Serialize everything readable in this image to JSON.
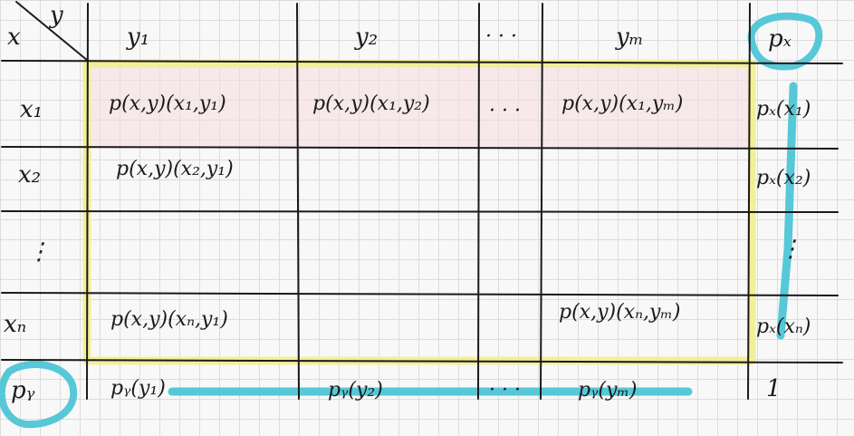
{
  "colors": {
    "ink": "#1a1a1a",
    "grid": "#dcdcdc",
    "highlight_yellow": "#f2ef9a",
    "highlight_pink": "#f6dcdc",
    "highlight_cyan": "#56c8d8"
  },
  "corner": {
    "x_label": "x",
    "y_label": "y"
  },
  "header": {
    "y1": "y₁",
    "y2": "y₂",
    "dots": "· · ·",
    "ym": "yₘ",
    "px": "pₓ"
  },
  "rows": [
    {
      "x": "x₁",
      "cells": [
        "p(x,y)(x₁,y₁)",
        "p(x,y)(x₁,y₂)",
        "· · ·",
        "p(x,y)(x₁,yₘ)"
      ],
      "marginal": "pₓ(x₁)"
    },
    {
      "x": "x₂",
      "cells": [
        "p(x,y)(x₂,y₁)",
        "",
        "",
        ""
      ],
      "marginal": "pₓ(x₂)"
    },
    {
      "x": "⋮",
      "cells": [
        "",
        "",
        "",
        ""
      ],
      "marginal": "⋮"
    },
    {
      "x": "xₙ",
      "cells": [
        "p(x,y)(xₙ,y₁)",
        "",
        "",
        "p(x,y)(xₙ,yₘ)"
      ],
      "marginal": "pₓ(xₙ)"
    }
  ],
  "footer": {
    "py": "pᵧ",
    "py_y1": "pᵧ(y₁)",
    "py_y2": "pᵧ(y₂)",
    "dots": "· · ·",
    "py_ym": "pᵧ(yₘ)",
    "total": "1"
  }
}
